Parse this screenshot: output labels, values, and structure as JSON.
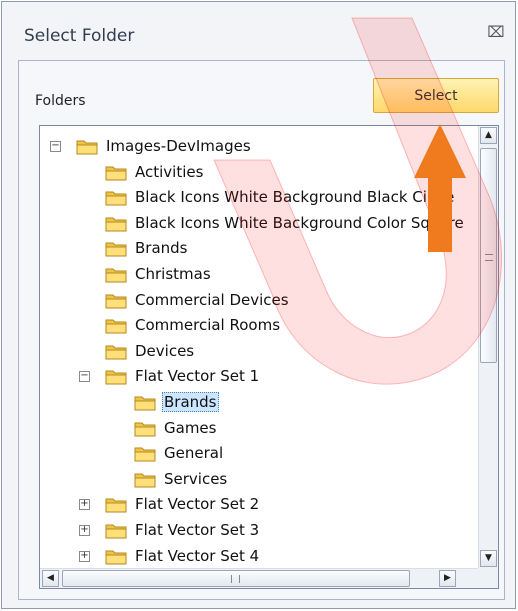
{
  "dialog": {
    "title": "Select Folder",
    "close_glyph": "⌧"
  },
  "panel": {
    "folders_label": "Folders",
    "select_label": "Select"
  },
  "tree": [
    {
      "label": "Images-DevImages",
      "level": 0,
      "expander": "−"
    },
    {
      "label": "Activities",
      "level": 1,
      "expander": ""
    },
    {
      "label": "Black Icons White Background Black Circle",
      "level": 1,
      "expander": ""
    },
    {
      "label": "Black Icons White Background Color Square",
      "level": 1,
      "expander": ""
    },
    {
      "label": "Brands",
      "level": 1,
      "expander": ""
    },
    {
      "label": "Christmas",
      "level": 1,
      "expander": ""
    },
    {
      "label": "Commercial Devices",
      "level": 1,
      "expander": ""
    },
    {
      "label": "Commercial Rooms",
      "level": 1,
      "expander": ""
    },
    {
      "label": "Devices",
      "level": 1,
      "expander": ""
    },
    {
      "label": "Flat Vector Set 1",
      "level": 1,
      "expander": "−"
    },
    {
      "label": "Brands",
      "level": 2,
      "expander": "",
      "selected": true
    },
    {
      "label": "Games",
      "level": 2,
      "expander": ""
    },
    {
      "label": "General",
      "level": 2,
      "expander": ""
    },
    {
      "label": "Services",
      "level": 2,
      "expander": ""
    },
    {
      "label": "Flat Vector Set 2",
      "level": 1,
      "expander": "+"
    },
    {
      "label": "Flat Vector Set 3",
      "level": 1,
      "expander": "+"
    },
    {
      "label": "Flat Vector Set 4",
      "level": 1,
      "expander": "+"
    }
  ],
  "scrollbars": {
    "up": "▲",
    "down": "▼",
    "left": "◀",
    "right": "▶"
  },
  "colors": {
    "accent_button": "#ffd86a",
    "selection": "#cce6ff",
    "arrow": "#f07a1e",
    "watermark": "#ff0000"
  }
}
